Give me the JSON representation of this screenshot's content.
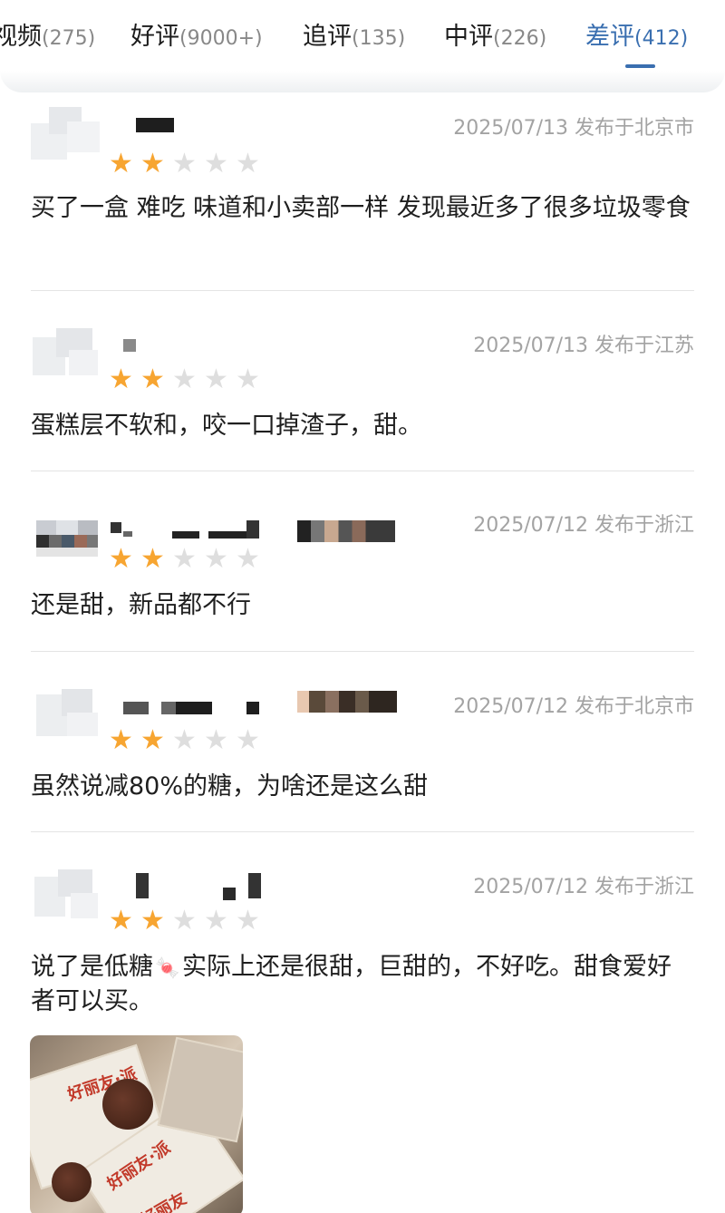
{
  "tabs": [
    {
      "label": "视频",
      "count": "(275)",
      "active": false
    },
    {
      "label": "好评",
      "count": "(9000+)",
      "active": false
    },
    {
      "label": "追评",
      "count": "(135)",
      "active": false
    },
    {
      "label": "中评",
      "count": "(226)",
      "active": false
    },
    {
      "label": "差评",
      "count": "(412)",
      "active": true
    }
  ],
  "reviews": [
    {
      "meta": "2025/07/13 发布于北京市",
      "rating": 2,
      "max_rating": 5,
      "text": "买了一盒 难吃 味道和小卖部一样 发现最近多了很多垃圾零食"
    },
    {
      "meta": "2025/07/13 发布于江苏",
      "rating": 2,
      "max_rating": 5,
      "text": "蛋糕层不软和，咬一口掉渣子，甜。"
    },
    {
      "meta": "2025/07/12 发布于浙江",
      "rating": 2,
      "max_rating": 5,
      "text": "还是甜，新品都不行"
    },
    {
      "meta": "2025/07/12 发布于北京市",
      "rating": 2,
      "max_rating": 5,
      "text": "虽然说减80%的糖，为啥还是这么甜"
    },
    {
      "meta": "2025/07/12 发布于浙江",
      "rating": 2,
      "max_rating": 5,
      "text_before_icon": "说了是低糖",
      "icon": "candy-icon",
      "text_after_icon": "实际上还是很甜，巨甜的，不好吃。甜食爱好者可以买。"
    }
  ],
  "photo": {
    "wrapper_text_1": "好丽友·派",
    "wrapper_text_2": "好丽友·派",
    "wrapper_text_3": "好丽友"
  },
  "colors": {
    "accent": "#3a6fb0",
    "star_on": "#f7a531",
    "star_off": "#dedede",
    "meta": "#a3a3a3"
  }
}
